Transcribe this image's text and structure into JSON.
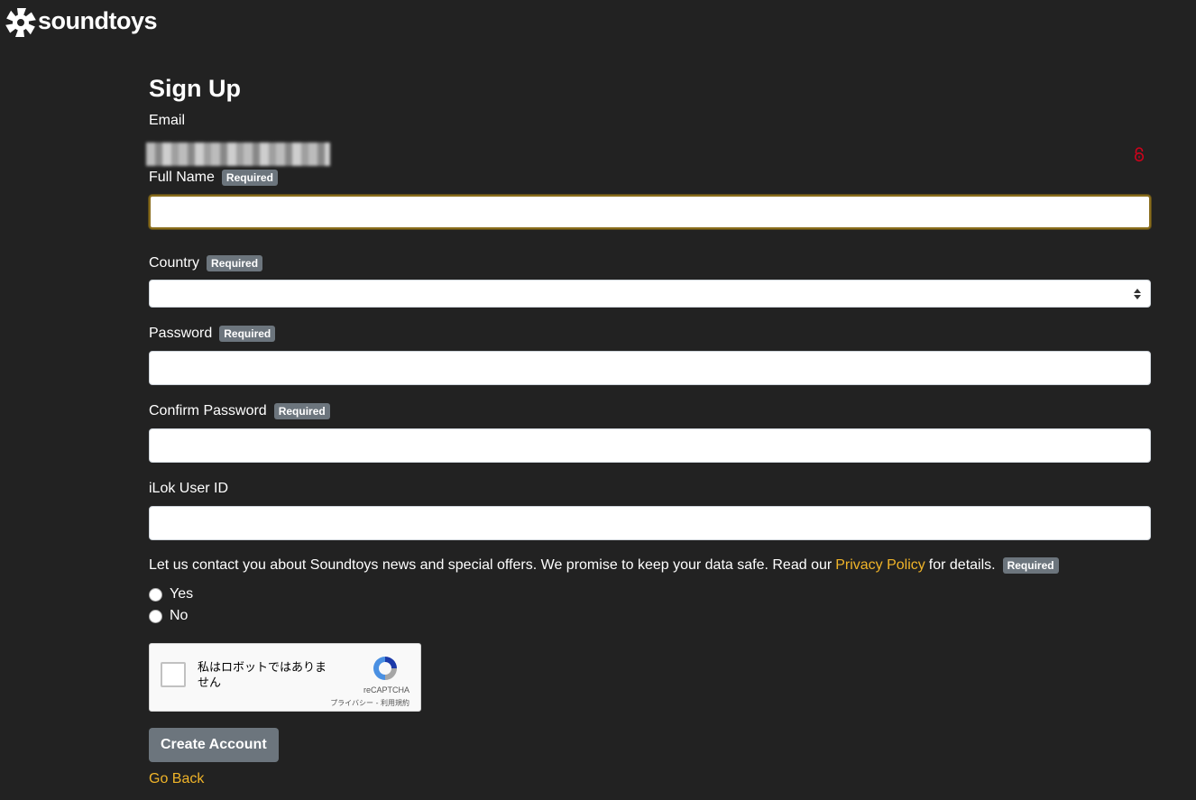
{
  "brand": {
    "name": "soundtoys"
  },
  "form": {
    "title": "Sign Up",
    "email_label": "Email",
    "required_badge": "Required",
    "full_name_label": "Full Name",
    "full_name_value": "",
    "country_label": "Country",
    "country_value": "",
    "password_label": "Password",
    "confirm_password_label": "Confirm Password",
    "ilok_label": "iLok User ID",
    "consent_text": "Let us contact you about Soundtoys news and special offers. We promise to keep your data safe. Read our",
    "privacy_link": "Privacy Policy",
    "consent_suffix": "for details.",
    "option_yes": "Yes",
    "option_no": "No",
    "submit_label": "Create Account",
    "go_back_label": "Go Back"
  },
  "recaptcha": {
    "label": "私はロボットではありません",
    "brand": "reCAPTCHA",
    "terms": "プライバシー - 利用規約"
  },
  "colors": {
    "background": "#222222",
    "accent_link": "#f0b429",
    "badge": "#6c757d",
    "lock_icon": "#d0021b"
  }
}
